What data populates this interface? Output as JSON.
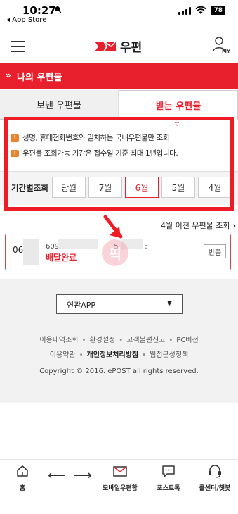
{
  "status_bar": {
    "time": "10:27",
    "back_app": "◂ App Store",
    "battery": "78"
  },
  "header": {
    "logo_text": "우편",
    "my_label": "MY"
  },
  "section": {
    "title": "나의 우편물"
  },
  "tabs": [
    {
      "label": "보낸 우편물",
      "active": false
    },
    {
      "label": "받는 우편물",
      "active": true
    }
  ],
  "notices": [
    "성명, 휴대전화번호와 일치하는 국내우편물만 조회",
    "우편물 조회가능 기간은 접수일 기준 최대 1년입니다."
  ],
  "period": {
    "label": "기간별조회",
    "options": [
      "당월",
      "7월",
      "6월",
      "5월",
      "4월"
    ],
    "selected": "6월"
  },
  "prev_link": {
    "label": "4월 이전 우편물 조회"
  },
  "item": {
    "date": "06",
    "number_prefix": "609",
    "number_suffix": "5 (발송인 :",
    "status": "배달완료",
    "return_button": "반품"
  },
  "watermark_text": "픽",
  "footer": {
    "related_app": "연관APP",
    "links_row1": [
      "이용내역조회",
      "환경설정",
      "고객불편신고",
      "PC버전"
    ],
    "links_row2": [
      "이용약관",
      "개인정보처리방침",
      "웹접근성정책"
    ],
    "copyright": "Copyright © 2016. ePOST all rights reserved."
  },
  "bottom_nav": {
    "home": "홈",
    "mobile_mail": "모바일우편함",
    "post_talk": "포스트톡",
    "call_center": "콜센터/챗봇"
  },
  "colors": {
    "brand_red": "#e8202e",
    "highlight_red": "#ee1c25"
  }
}
